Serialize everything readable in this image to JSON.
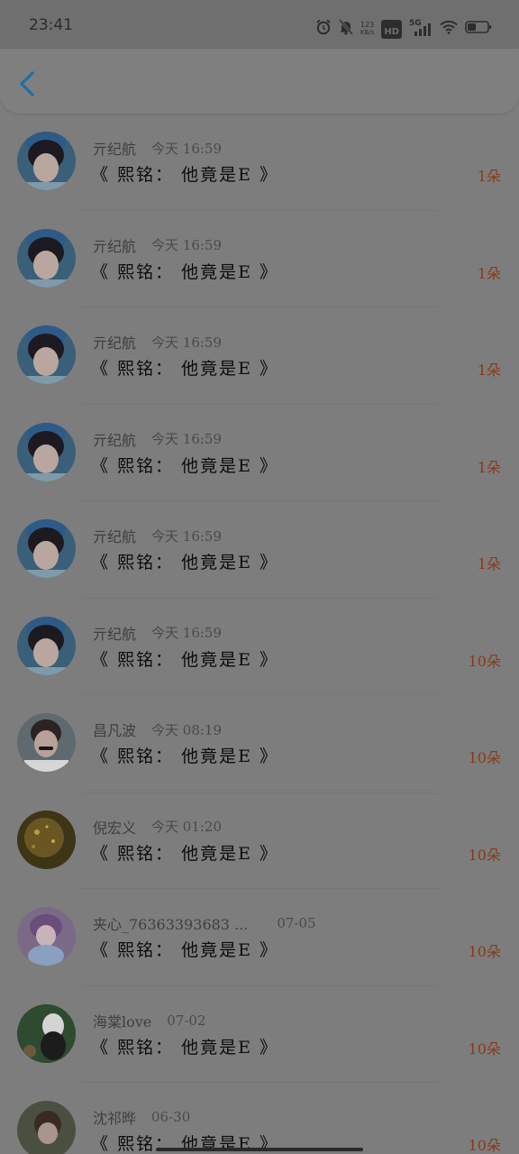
{
  "status_bar": {
    "time": "23:41",
    "net_speed_top": "123",
    "net_speed_bottom": "KB/s",
    "hd_label": "HD",
    "signal_label": "5G",
    "icons": [
      "alarm-icon",
      "mute-bell-icon",
      "hd-icon",
      "signal-5g-icon",
      "wifi-icon",
      "battery-icon"
    ]
  },
  "header": {
    "back_icon": "chevron-left-icon",
    "accent_color": "#1e6fa8"
  },
  "colors": {
    "amount": "#8a3a18",
    "title": "#0c0c0c",
    "background": "#7d7d7d"
  },
  "items": [
    {
      "name": "亓纪航",
      "time": "今天 16:59",
      "title": "《 熙铭： 他竟是E 》",
      "amount": "1朵",
      "avatar": "avatar-photo-boy-blue"
    },
    {
      "name": "亓纪航",
      "time": "今天 16:59",
      "title": "《 熙铭： 他竟是E 》",
      "amount": "1朵",
      "avatar": "avatar-photo-boy-blue"
    },
    {
      "name": "亓纪航",
      "time": "今天 16:59",
      "title": "《 熙铭： 他竟是E 》",
      "amount": "1朵",
      "avatar": "avatar-photo-boy-blue"
    },
    {
      "name": "亓纪航",
      "time": "今天 16:59",
      "title": "《 熙铭： 他竟是E 》",
      "amount": "1朵",
      "avatar": "avatar-photo-boy-blue"
    },
    {
      "name": "亓纪航",
      "time": "今天 16:59",
      "title": "《 熙铭： 他竟是E 》",
      "amount": "1朵",
      "avatar": "avatar-photo-boy-blue"
    },
    {
      "name": "亓纪航",
      "time": "今天 16:59",
      "title": "《 熙铭： 他竟是E 》",
      "amount": "10朵",
      "avatar": "avatar-photo-boy-blue"
    },
    {
      "name": "昌凡波",
      "time": "今天 08:19",
      "title": "《 熙铭： 他竟是E 》",
      "amount": "10朵",
      "avatar": "avatar-photo-boy-mustache"
    },
    {
      "name": "倪宏义",
      "time": "今天 01:20",
      "title": "《 熙铭： 他竟是E 》",
      "amount": "10朵",
      "avatar": "avatar-photo-golden-sparkle"
    },
    {
      "name": "夹心_76363393683 ...",
      "time": "07-05",
      "title": "《 熙铭： 他竟是E 》",
      "amount": "10朵",
      "avatar": "avatar-anime-purple"
    },
    {
      "name": "海棠love",
      "time": "07-02",
      "title": "《 熙铭： 他竟是E 》",
      "amount": "10朵",
      "avatar": "avatar-photo-white-hair"
    },
    {
      "name": "沈祁晔",
      "time": "06-30",
      "title": "《 熙铭： 他竟是E 》",
      "amount": "10朵",
      "avatar": "avatar-photo-outdoor"
    }
  ]
}
